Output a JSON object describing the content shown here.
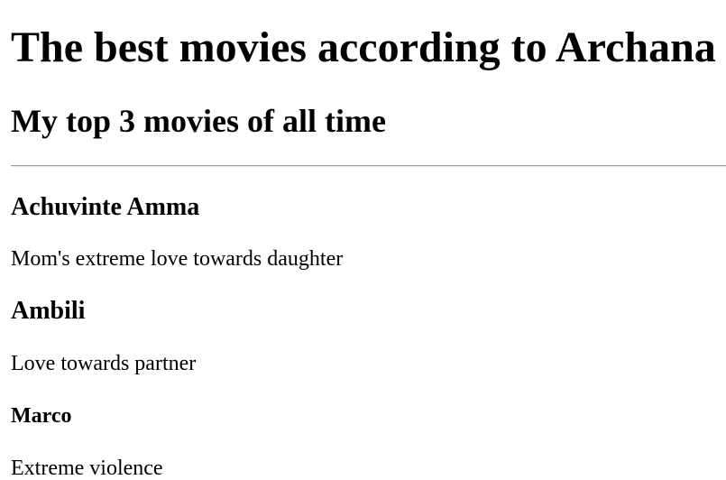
{
  "page": {
    "heading": "The best movies according to Archana",
    "subheading": "My top 3 movies of all time"
  },
  "movies": [
    {
      "title": "Achuvinte Amma",
      "description": "Mom's extreme love towards daughter"
    },
    {
      "title": "Ambili",
      "description": "Love towards partner"
    },
    {
      "title": "Marco",
      "description": "Extreme violence"
    }
  ]
}
